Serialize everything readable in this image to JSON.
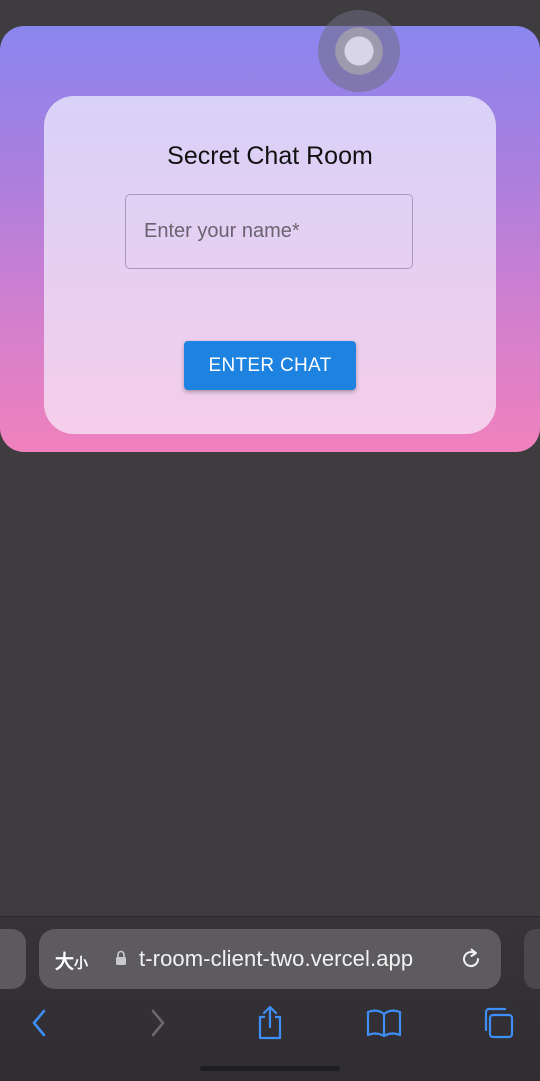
{
  "page": {
    "title": "Secret Chat Room",
    "name_placeholder": "Enter your name*",
    "enter_button_label": "ENTER CHAT"
  },
  "browser": {
    "text_size_label_big": "大",
    "text_size_label_small": "小",
    "url": "t-room-client-two.vercel.app",
    "toolbar": {
      "back_icon": "chevron-left-icon",
      "forward_icon": "chevron-right-icon",
      "share_icon": "share-icon",
      "bookmarks_icon": "book-icon",
      "tabs_icon": "tabs-icon"
    }
  },
  "colors": {
    "accent_blue": "#1e83e0",
    "toolbar_icon_blue": "#3d8ef7",
    "gradient_top": "#8a86ef",
    "gradient_bottom": "#f081bd",
    "background_dark": "#3e3c3f"
  }
}
